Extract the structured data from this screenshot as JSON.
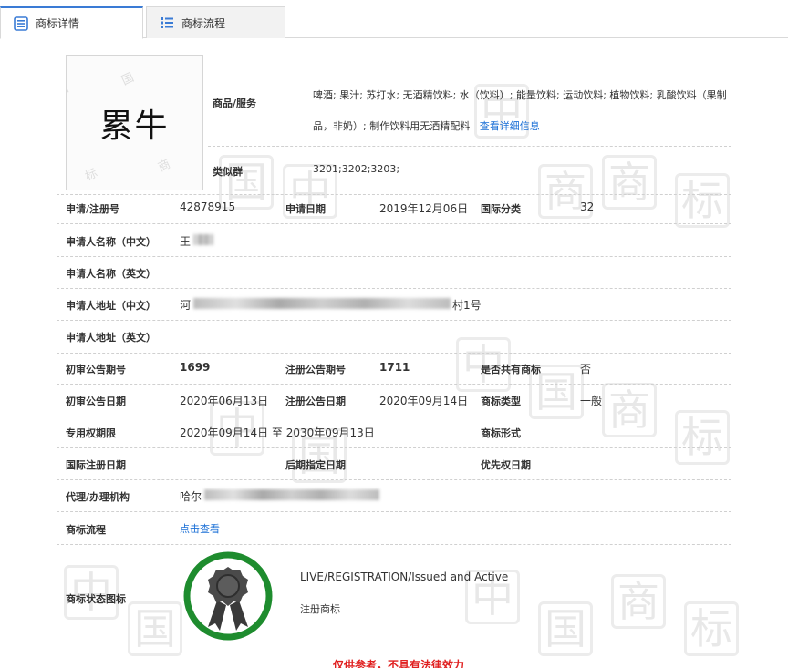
{
  "tabs": [
    {
      "label": "商标详情",
      "icon": "document-list-icon",
      "active": true
    },
    {
      "label": "商标流程",
      "icon": "list-icon",
      "active": false
    }
  ],
  "logo": {
    "text": "累牛"
  },
  "watermark_chars": [
    "中",
    "国",
    "商",
    "标"
  ],
  "goods": {
    "label": "商品/服务",
    "text": "啤酒; 果汁; 苏打水; 无酒精饮料; 水（饮料）; 能量饮料; 运动饮料; 植物饮料; 乳酸饮料（果制品，非奶）; 制作饮料用无酒精配料",
    "detail_link": "查看详细信息"
  },
  "similar_group": {
    "label": "类似群",
    "value": "3201;3202;3203;"
  },
  "fields": {
    "reg_no_label": "申请/注册号",
    "reg_no": "42878915",
    "app_date_label": "申请日期",
    "app_date": "2019年12月06日",
    "intl_class_label": "国际分类",
    "intl_class": "32",
    "applicant_cn_label": "申请人名称（中文）",
    "applicant_cn": "王",
    "applicant_en_label": "申请人名称（英文）",
    "address_cn_label": "申请人地址（中文）",
    "address_cn_start": "河",
    "address_cn_end": "村1号",
    "address_en_label": "申请人地址（英文）",
    "prelim_issue_label": "初审公告期号",
    "prelim_issue": "1699",
    "reg_issue_label": "注册公告期号",
    "reg_issue": "1711",
    "shared_label": "是否共有商标",
    "shared": "否",
    "prelim_date_label": "初审公告日期",
    "prelim_date": "2020年06月13日",
    "reg_date_label": "注册公告日期",
    "reg_date": "2020年09月14日",
    "tm_type_label": "商标类型",
    "tm_type": "一般",
    "exclusive_label": "专用权期限",
    "exclusive": "2020年09月14日 至 2030年09月13日",
    "tm_form_label": "商标形式",
    "intl_reg_date_label": "国际注册日期",
    "later_designation_label": "后期指定日期",
    "priority_date_label": "优先权日期",
    "agent_label": "代理/办理机构",
    "agent_start": "哈尔",
    "process_label": "商标流程",
    "process_link": "点击查看",
    "status_icon_label": "商标状态图标"
  },
  "status": {
    "en": "LIVE/REGISTRATION/Issued and Active",
    "cn": "注册商标",
    "seal_icon": "award-ribbon-icon",
    "ring_color": "#1e8c2e"
  },
  "footer_note": "仅供参考，不具有法律效力"
}
